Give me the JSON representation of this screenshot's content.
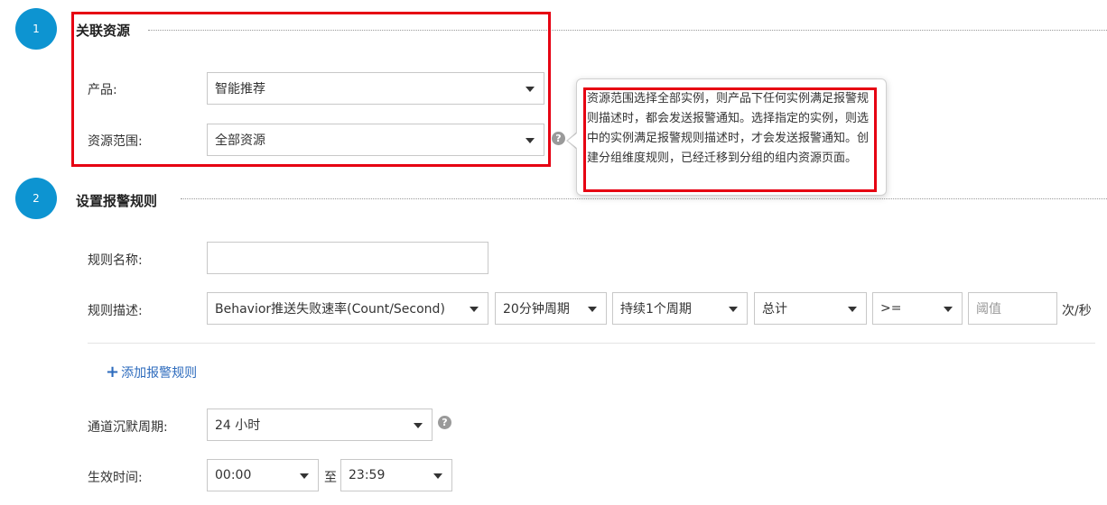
{
  "section1": {
    "step": "1",
    "title": "关联资源",
    "product_label": "产品:",
    "product_value": "智能推荐",
    "scope_label": "资源范围:",
    "scope_value": "全部资源",
    "tooltip": "资源范围选择全部实例，则产品下任何实例满足报警规则描述时，都会发送报警通知。选择指定的实例，则选中的实例满足报警规则描述时，才会发送报警通知。创建分组维度规则，已经迁移到分组的组内资源页面。"
  },
  "section2": {
    "step": "2",
    "title": "设置报警规则",
    "rule_name_label": "规则名称:",
    "rule_name_value": "",
    "rule_desc_label": "规则描述:",
    "metric": "Behavior推送失败速率(Count/Second)",
    "period": "20分钟周期",
    "duration": "持续1个周期",
    "aggregation": "总计",
    "operator": ">=",
    "threshold_placeholder": "阈值",
    "unit": "次/秒",
    "add_rule": "添加报警规则",
    "silence_label": "通道沉默周期:",
    "silence_value": "24 小时",
    "effective_label": "生效时间:",
    "effective_start": "00:00",
    "effective_to": "至",
    "effective_end": "23:59"
  },
  "icons": {
    "help": "question-icon",
    "add": "plus-icon",
    "dropdown": "caret-down-icon"
  },
  "colors": {
    "step_circle": "#0d94d1",
    "highlight": "#e60012",
    "link": "#2d6bbd"
  }
}
